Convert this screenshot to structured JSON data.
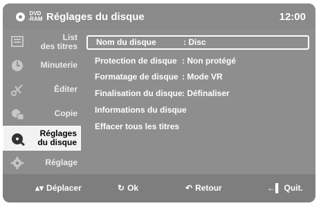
{
  "header": {
    "disc_type_line1": "DVD",
    "disc_type_line2": "-RAM",
    "title": "Réglages du disque",
    "clock": "12:00"
  },
  "sidebar": {
    "items": [
      {
        "label": "List\ndes titres",
        "icon": "list-icon",
        "active": false
      },
      {
        "label": "Minuterie",
        "icon": "timer-icon",
        "active": false
      },
      {
        "label": "Éditer",
        "icon": "scissors-icon",
        "active": false
      },
      {
        "label": "Copie",
        "icon": "copy-icon",
        "active": false
      },
      {
        "label": "Réglages\ndu disque",
        "icon": "disc-settings-icon",
        "active": true
      },
      {
        "label": "Réglage",
        "icon": "gear-icon",
        "active": false
      }
    ]
  },
  "menu": {
    "rows": [
      {
        "label": "Nom du disque",
        "value": ": Disc",
        "selected": true
      },
      {
        "label": "Protection de disque",
        "value": ": Non protégé",
        "selected": false
      },
      {
        "label": "Formatage de disque",
        "value": ": Mode VR",
        "selected": false
      },
      {
        "label": "Finalisation du disque",
        "value": ": Définaliser",
        "selected": false
      },
      {
        "label": "Informations du disque",
        "value": "",
        "selected": false
      },
      {
        "label": "Effacer tous les titres",
        "value": "",
        "selected": false
      }
    ]
  },
  "footer": {
    "move_label": "Déplacer",
    "ok_label": "Ok",
    "back_label": "Retour",
    "exit_label": "Quit."
  }
}
